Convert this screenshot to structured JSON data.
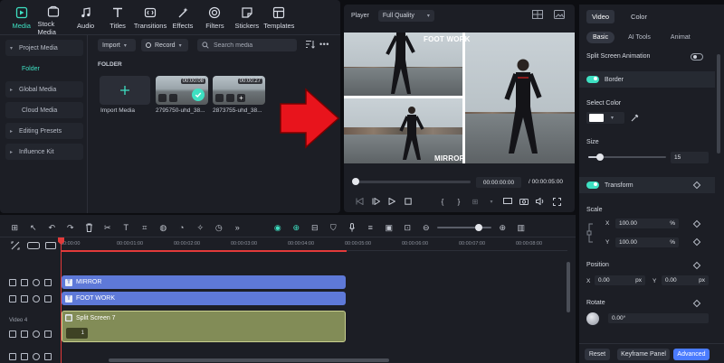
{
  "media_tabs": [
    {
      "label": "Media",
      "icon": "media-icon",
      "active": true
    },
    {
      "label": "Stock Media",
      "icon": "stock-media-icon",
      "active": false
    },
    {
      "label": "Audio",
      "icon": "music-note-icon",
      "active": false
    },
    {
      "label": "Titles",
      "icon": "titles-icon",
      "active": false
    },
    {
      "label": "Transitions",
      "icon": "transitions-icon",
      "active": false
    },
    {
      "label": "Effects",
      "icon": "effects-icon",
      "active": false
    },
    {
      "label": "Filters",
      "icon": "filters-icon",
      "active": false
    },
    {
      "label": "Stickers",
      "icon": "stickers-icon",
      "active": false
    },
    {
      "label": "Templates",
      "icon": "templates-icon",
      "active": false
    }
  ],
  "left_nav": {
    "items": [
      "Project Media",
      "Folder",
      "Global Media",
      "Cloud Media",
      "Editing Presets",
      "Influence Kit"
    ]
  },
  "media_toolbar": {
    "import_label": "Import",
    "record_label": "Record",
    "search_placeholder": "Search media"
  },
  "folder_section": {
    "heading": "FOLDER",
    "import_tile_label": "Import Media",
    "clips": [
      {
        "name": "2795750-uhd_38...",
        "duration": "00:00:08"
      },
      {
        "name": "2873755-uhd_38...",
        "duration": "00:00:27"
      }
    ]
  },
  "player": {
    "label": "Player",
    "quality": "Full Quality",
    "current_time": "00:00:00:00",
    "separator": "/",
    "total_time": "00:00:05:00",
    "progress": 0,
    "video_labels": [
      "FOOT WORK",
      "MIRROR"
    ]
  },
  "properties": {
    "tabs": [
      "Video",
      "Color"
    ],
    "subtabs": [
      "Basic",
      "AI Tools",
      "Animat"
    ],
    "split_screen_animation": "Split Screen Animation",
    "border_label": "Border",
    "select_color_label": "Select Color",
    "size_label": "Size",
    "size_value": "15",
    "size_fraction": 0.15,
    "transform_label": "Transform",
    "scale_label": "Scale",
    "scale_x_label": "X",
    "scale_x": "100.00",
    "scale_y_label": "Y",
    "scale_y": "100.00",
    "percent": "%",
    "position_label": "Position",
    "pos_x_label": "X",
    "pos_x": "0.00",
    "pos_y_label": "Y",
    "pos_y": "0.00",
    "px_unit": "px",
    "rotate_label": "Rotate",
    "rotate_value": "0.00°",
    "reset_label": "Reset",
    "keyframe_label": "Keyframe Panel",
    "advanced_label": "Advanced",
    "accent": "#3ee0c2",
    "advanced_color": "#4a7bff"
  },
  "timeline": {
    "ticks": [
      "00:00:00",
      "00:00:01:00",
      "00:00:02:00",
      "00:00:03:00",
      "00:00:04:00",
      "00:00:05:00",
      "00:00:06:00",
      "00:00:07:00",
      "00:00:08:00"
    ],
    "track_label_video4": "Video 4",
    "clips": {
      "mirror": "MIRROR",
      "footwork": "FOOT WORK",
      "split": "Split Screen 7",
      "split_count": "1"
    },
    "clip_colors": {
      "text": "#5e79d8",
      "split": "#828c57"
    }
  },
  "annotation": {
    "arrow_color": "#e8141c"
  }
}
